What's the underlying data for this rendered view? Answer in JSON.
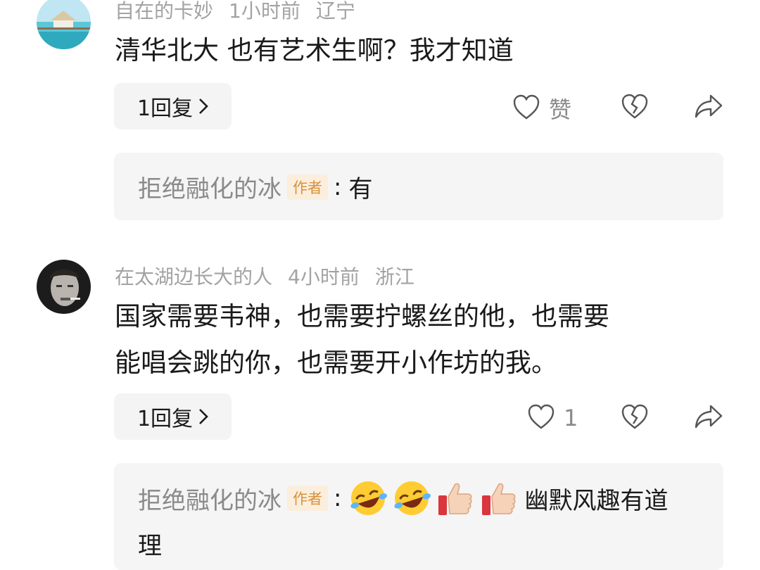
{
  "comments": [
    {
      "author": "自在的卡妙",
      "time": "1小时前",
      "location": "辽宁",
      "text": "清华北大 也有艺术生啊？我才知道",
      "reply_label": "1回复",
      "like_label": "赞",
      "sub_reply": {
        "author": "拒绝融化的冰",
        "badge": "作者",
        "colon": ":",
        "text": "有"
      }
    },
    {
      "author": "在太湖边长大的人",
      "time": "4小时前",
      "location": "浙江",
      "text_line1": "国家需要韦神，也需要拧螺丝的他，也需要",
      "text_line2": "能唱会跳的你，也需要开小作坊的我。",
      "reply_label": "1回复",
      "like_label": "1",
      "sub_reply": {
        "author": "拒绝融化的冰",
        "badge": "作者",
        "colon": ":",
        "emojis": [
          "laughing-crying-emoji",
          "laughing-crying-emoji",
          "thumbs-up-emoji",
          "thumbs-up-emoji"
        ],
        "text_line1": "幽默风趣有道",
        "text_line2": "理"
      }
    }
  ],
  "colors": {
    "meta": "#a3a3a3",
    "badge_bg": "#fbeedc",
    "badge_text": "#d7923b",
    "reply_bg": "#f4f4f4"
  }
}
